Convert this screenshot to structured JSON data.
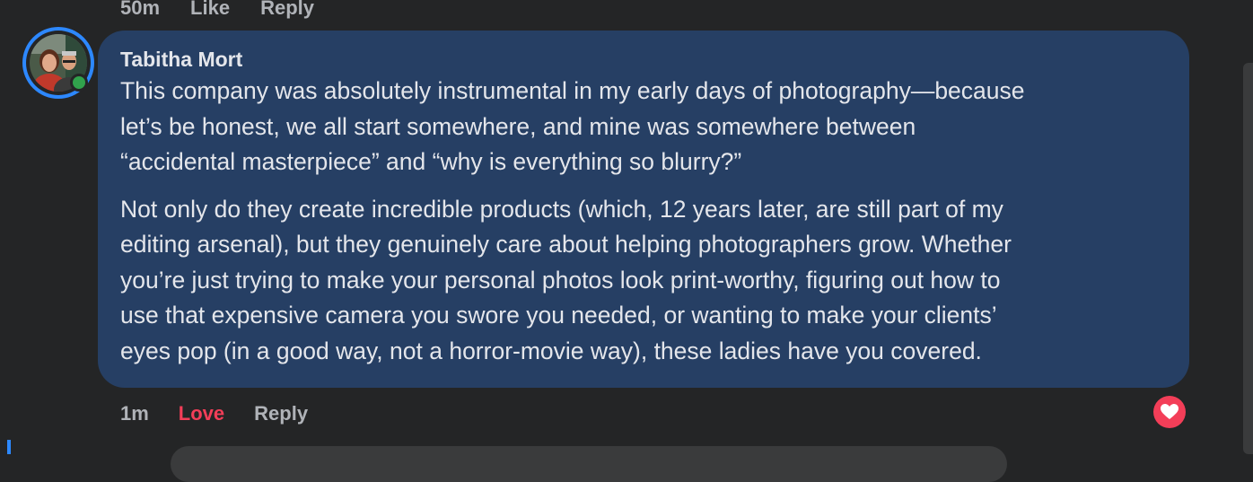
{
  "previous_comment": {
    "time": "50m",
    "like_label": "Like",
    "reply_label": "Reply"
  },
  "comment": {
    "author": "Tabitha Mort",
    "paragraphs": [
      [
        "This company was absolutely instrumental in my early days of photography—because",
        "let’s be honest, we all start somewhere, and mine was somewhere between",
        "“accidental masterpiece” and “why is everything so blurry?”"
      ],
      [
        "Not only do they create incredible products (which, 12 years later, are still part of my",
        "editing arsenal), but they genuinely care about helping photographers grow. Whether",
        "you’re just trying to make your personal photos look print-worthy, figuring out how to",
        "use that expensive camera you swore you needed, or wanting to make your clients’",
        "eyes pop (in a good way, not a horror-movie way), these ladies have you covered."
      ]
    ],
    "time": "1m",
    "reaction_label": "Love",
    "reply_label": "Reply",
    "reaction_icon": "heart-icon"
  },
  "colors": {
    "background": "#242526",
    "bubble": "#263f64",
    "text": "#e4e6eb",
    "secondary_text": "#b0b3b8",
    "love": "#f33e58",
    "accent": "#2d88ff",
    "online": "#31a24c"
  }
}
